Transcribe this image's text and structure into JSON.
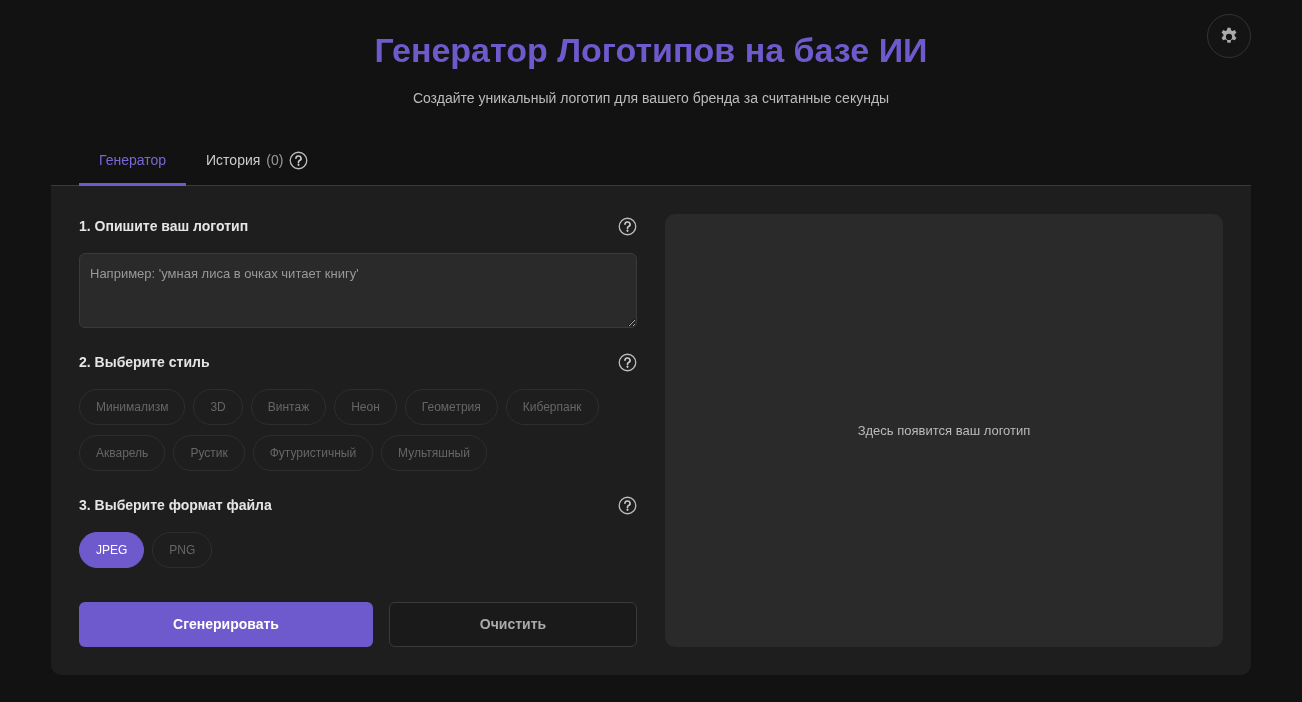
{
  "header": {
    "title": "Генератор Логотипов на базе ИИ",
    "subtitle": "Создайте уникальный логотип для вашего бренда за считанные секунды"
  },
  "tabs": [
    {
      "label": "Генератор",
      "selected": true
    },
    {
      "label": "История",
      "count": "(0)",
      "selected": false
    }
  ],
  "sections": [
    {
      "kind": "text",
      "title": "1. Опишите ваш логотип",
      "placeholder": "Например: 'умная лиса в очках читает книгу'"
    },
    {
      "kind": "chips",
      "title": "2. Выберите стиль",
      "options": [
        {
          "label": "Минимализм",
          "selected": false
        },
        {
          "label": "3D",
          "selected": false
        },
        {
          "label": "Винтаж",
          "selected": false
        },
        {
          "label": "Неон",
          "selected": false
        },
        {
          "label": "Геометрия",
          "selected": false
        },
        {
          "label": "Киберпанк",
          "selected": false
        },
        {
          "label": "Акварель",
          "selected": false
        },
        {
          "label": "Рустик",
          "selected": false
        },
        {
          "label": "Футуристичный",
          "selected": false
        },
        {
          "label": "Мультяшный",
          "selected": false
        }
      ]
    },
    {
      "kind": "chips",
      "title": "3. Выберите формат файла",
      "options": [
        {
          "label": "JPEG",
          "selected": true
        },
        {
          "label": "PNG",
          "selected": false
        }
      ]
    }
  ],
  "buttons": [
    {
      "kind": "primary",
      "label": "Сгенерировать"
    },
    {
      "kind": "outline",
      "label": "Очистить"
    }
  ],
  "preview": {
    "text": "Здесь появится ваш логотип"
  }
}
